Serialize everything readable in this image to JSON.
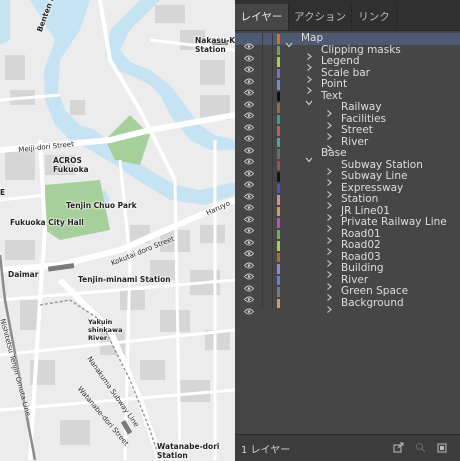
{
  "map": {
    "labels": {
      "benten_bridge": "Benten Bridg",
      "nakasu_kawabata": "Nakasu-Kaw",
      "station": "Station",
      "meiji_dori": "Meiji-dori Street",
      "acros": "ACROS",
      "fukuoka": "Fukuoka",
      "tenjin_chuo_park": "Tenjin Chuo Park",
      "fukuoka_city_hall": "Fukuoka City Hall",
      "kokutai_doro": "Kokutai doro Street",
      "haruyoshi": "Haruyo",
      "daimaru": "Daimar",
      "tenjin_minami": "Tenjin-minami Station",
      "yakuin_shinkawa": "Yakuin\nshinkawa\nRiver",
      "nishitetsu": "Nishitetsu Tenjin Omuta Line",
      "nanakuma": "Nanakuma Subway Line",
      "watanabe_dori_street": "Watanabe-dori Street",
      "watanabe_dori_station": "Watanabe-dori",
      "watanabe_station": "Station",
      "edge_e": "E"
    },
    "colors": {
      "land": "#ececec",
      "water": "#c6e3f4",
      "park": "#a7cf9b",
      "block": "#d6d6d6",
      "road": "#ffffff",
      "rail": "#8c8c8c"
    }
  },
  "panel": {
    "tabs": [
      "レイヤー",
      "アクション",
      "リンク"
    ],
    "layers": [
      {
        "name": "Map",
        "level": 0,
        "expanded": true,
        "color": "#e06a2b",
        "selected": true
      },
      {
        "name": "Clipping masks",
        "level": 1,
        "expanded": false,
        "color": "#6aa84f"
      },
      {
        "name": "Legend",
        "level": 1,
        "expanded": false,
        "color": "#9fd44a"
      },
      {
        "name": "Scale bar",
        "level": 1,
        "expanded": false,
        "color": "#7b6fc8"
      },
      {
        "name": "Point",
        "level": 1,
        "expanded": false,
        "color": "#6b8fd6"
      },
      {
        "name": "Text",
        "level": 1,
        "expanded": true,
        "color": "#111111"
      },
      {
        "name": "Railway",
        "level": 2,
        "expanded": false,
        "color": "#a06a3a"
      },
      {
        "name": "Facilities",
        "level": 2,
        "expanded": false,
        "color": "#3c9c9c"
      },
      {
        "name": "Street",
        "level": 2,
        "expanded": false,
        "color": "#d45353"
      },
      {
        "name": "River",
        "level": 2,
        "expanded": false,
        "color": "#4aa7a7"
      },
      {
        "name": "Base",
        "level": 1,
        "expanded": true,
        "color": "#6b6b6b"
      },
      {
        "name": "Subway Station",
        "level": 2,
        "expanded": false,
        "color": "#a05050"
      },
      {
        "name": "Subway Line",
        "level": 2,
        "expanded": false,
        "color": "#151515"
      },
      {
        "name": "Expressway",
        "level": 2,
        "expanded": false,
        "color": "#4c55c8"
      },
      {
        "name": "Station",
        "level": 2,
        "expanded": false,
        "color": "#d98f8f"
      },
      {
        "name": "JR Line01",
        "level": 2,
        "expanded": false,
        "color": "#c8a060"
      },
      {
        "name": "Private Railway Line",
        "level": 2,
        "expanded": false,
        "color": "#c24fbf"
      },
      {
        "name": "Road01",
        "level": 2,
        "expanded": false,
        "color": "#6bb64a"
      },
      {
        "name": "Road02",
        "level": 2,
        "expanded": false,
        "color": "#9fd44a"
      },
      {
        "name": "Road03",
        "level": 2,
        "expanded": false,
        "color": "#b06a2a"
      },
      {
        "name": "Building",
        "level": 2,
        "expanded": false,
        "color": "#8a8ad6"
      },
      {
        "name": "River",
        "level": 2,
        "expanded": false,
        "color": "#5a86d6"
      },
      {
        "name": "Green Space",
        "level": 2,
        "expanded": false,
        "color": "#7a7a7a"
      },
      {
        "name": "Background",
        "level": 2,
        "expanded": false,
        "color": "#d89a6a"
      }
    ],
    "footer": {
      "label": "1 レイヤー"
    },
    "icons": [
      "eye-icon",
      "chevron-right-icon",
      "chevron-down-icon",
      "export-icon",
      "search-icon",
      "new-layer-icon"
    ]
  }
}
